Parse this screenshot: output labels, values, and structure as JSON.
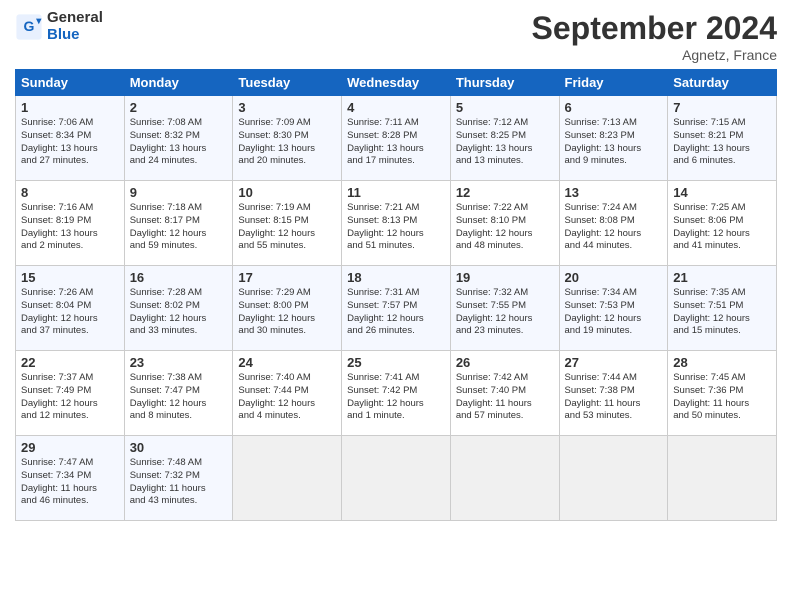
{
  "header": {
    "logo_line1": "General",
    "logo_line2": "Blue",
    "month_year": "September 2024",
    "location": "Agnetz, France"
  },
  "days_of_week": [
    "Sunday",
    "Monday",
    "Tuesday",
    "Wednesday",
    "Thursday",
    "Friday",
    "Saturday"
  ],
  "weeks": [
    [
      {
        "day": "1",
        "info": "Sunrise: 7:06 AM\nSunset: 8:34 PM\nDaylight: 13 hours\nand 27 minutes."
      },
      {
        "day": "2",
        "info": "Sunrise: 7:08 AM\nSunset: 8:32 PM\nDaylight: 13 hours\nand 24 minutes."
      },
      {
        "day": "3",
        "info": "Sunrise: 7:09 AM\nSunset: 8:30 PM\nDaylight: 13 hours\nand 20 minutes."
      },
      {
        "day": "4",
        "info": "Sunrise: 7:11 AM\nSunset: 8:28 PM\nDaylight: 13 hours\nand 17 minutes."
      },
      {
        "day": "5",
        "info": "Sunrise: 7:12 AM\nSunset: 8:25 PM\nDaylight: 13 hours\nand 13 minutes."
      },
      {
        "day": "6",
        "info": "Sunrise: 7:13 AM\nSunset: 8:23 PM\nDaylight: 13 hours\nand 9 minutes."
      },
      {
        "day": "7",
        "info": "Sunrise: 7:15 AM\nSunset: 8:21 PM\nDaylight: 13 hours\nand 6 minutes."
      }
    ],
    [
      {
        "day": "8",
        "info": "Sunrise: 7:16 AM\nSunset: 8:19 PM\nDaylight: 13 hours\nand 2 minutes."
      },
      {
        "day": "9",
        "info": "Sunrise: 7:18 AM\nSunset: 8:17 PM\nDaylight: 12 hours\nand 59 minutes."
      },
      {
        "day": "10",
        "info": "Sunrise: 7:19 AM\nSunset: 8:15 PM\nDaylight: 12 hours\nand 55 minutes."
      },
      {
        "day": "11",
        "info": "Sunrise: 7:21 AM\nSunset: 8:13 PM\nDaylight: 12 hours\nand 51 minutes."
      },
      {
        "day": "12",
        "info": "Sunrise: 7:22 AM\nSunset: 8:10 PM\nDaylight: 12 hours\nand 48 minutes."
      },
      {
        "day": "13",
        "info": "Sunrise: 7:24 AM\nSunset: 8:08 PM\nDaylight: 12 hours\nand 44 minutes."
      },
      {
        "day": "14",
        "info": "Sunrise: 7:25 AM\nSunset: 8:06 PM\nDaylight: 12 hours\nand 41 minutes."
      }
    ],
    [
      {
        "day": "15",
        "info": "Sunrise: 7:26 AM\nSunset: 8:04 PM\nDaylight: 12 hours\nand 37 minutes."
      },
      {
        "day": "16",
        "info": "Sunrise: 7:28 AM\nSunset: 8:02 PM\nDaylight: 12 hours\nand 33 minutes."
      },
      {
        "day": "17",
        "info": "Sunrise: 7:29 AM\nSunset: 8:00 PM\nDaylight: 12 hours\nand 30 minutes."
      },
      {
        "day": "18",
        "info": "Sunrise: 7:31 AM\nSunset: 7:57 PM\nDaylight: 12 hours\nand 26 minutes."
      },
      {
        "day": "19",
        "info": "Sunrise: 7:32 AM\nSunset: 7:55 PM\nDaylight: 12 hours\nand 23 minutes."
      },
      {
        "day": "20",
        "info": "Sunrise: 7:34 AM\nSunset: 7:53 PM\nDaylight: 12 hours\nand 19 minutes."
      },
      {
        "day": "21",
        "info": "Sunrise: 7:35 AM\nSunset: 7:51 PM\nDaylight: 12 hours\nand 15 minutes."
      }
    ],
    [
      {
        "day": "22",
        "info": "Sunrise: 7:37 AM\nSunset: 7:49 PM\nDaylight: 12 hours\nand 12 minutes."
      },
      {
        "day": "23",
        "info": "Sunrise: 7:38 AM\nSunset: 7:47 PM\nDaylight: 12 hours\nand 8 minutes."
      },
      {
        "day": "24",
        "info": "Sunrise: 7:40 AM\nSunset: 7:44 PM\nDaylight: 12 hours\nand 4 minutes."
      },
      {
        "day": "25",
        "info": "Sunrise: 7:41 AM\nSunset: 7:42 PM\nDaylight: 12 hours\nand 1 minute."
      },
      {
        "day": "26",
        "info": "Sunrise: 7:42 AM\nSunset: 7:40 PM\nDaylight: 11 hours\nand 57 minutes."
      },
      {
        "day": "27",
        "info": "Sunrise: 7:44 AM\nSunset: 7:38 PM\nDaylight: 11 hours\nand 53 minutes."
      },
      {
        "day": "28",
        "info": "Sunrise: 7:45 AM\nSunset: 7:36 PM\nDaylight: 11 hours\nand 50 minutes."
      }
    ],
    [
      {
        "day": "29",
        "info": "Sunrise: 7:47 AM\nSunset: 7:34 PM\nDaylight: 11 hours\nand 46 minutes."
      },
      {
        "day": "30",
        "info": "Sunrise: 7:48 AM\nSunset: 7:32 PM\nDaylight: 11 hours\nand 43 minutes."
      },
      {
        "day": "",
        "info": ""
      },
      {
        "day": "",
        "info": ""
      },
      {
        "day": "",
        "info": ""
      },
      {
        "day": "",
        "info": ""
      },
      {
        "day": "",
        "info": ""
      }
    ]
  ]
}
